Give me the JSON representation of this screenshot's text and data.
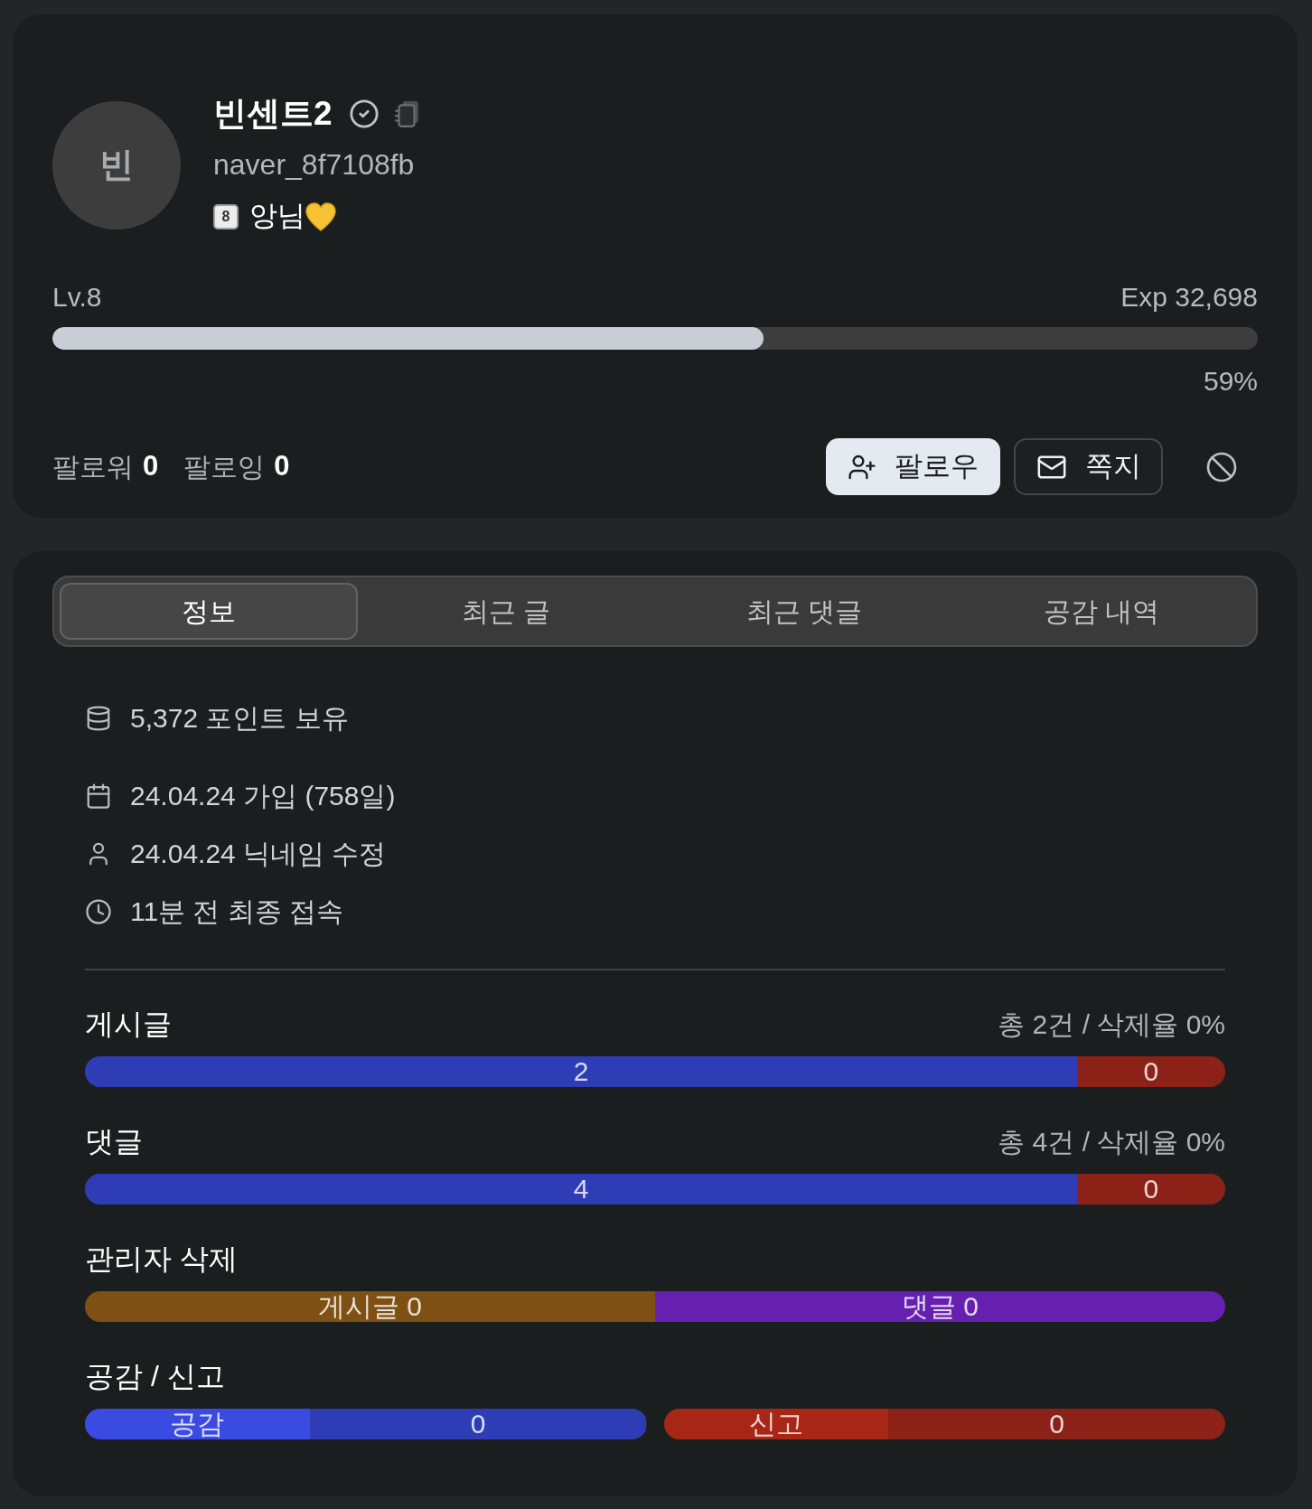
{
  "profile": {
    "avatar_initial": "빈",
    "name": "빈센트2",
    "username": "naver_8f7108fb",
    "level_badge": "8",
    "nickname": "앙님"
  },
  "level": {
    "label": "Lv.8",
    "exp": "Exp 32,698",
    "level": 0.59,
    "percent": "59%"
  },
  "follow": {
    "followers_label": "팔로워",
    "followers": "0",
    "following_label": "팔로잉",
    "following": "0"
  },
  "actions": [
    {
      "kind": "follow",
      "label": "팔로우"
    },
    {
      "kind": "message",
      "label": "쪽지"
    },
    {
      "kind": "block"
    }
  ],
  "tabs": [
    {
      "label": "정보",
      "selected": true
    },
    {
      "label": "최근 글",
      "selected": false
    },
    {
      "label": "최근 댓글",
      "selected": false
    },
    {
      "label": "공감 내역",
      "selected": false
    }
  ],
  "points": {
    "kind": "points",
    "text": "5,372 포인트 보유"
  },
  "details": [
    {
      "kind": "joined",
      "text": "24.04.24 가입 (758일)"
    },
    {
      "kind": "nickname",
      "text": "24.04.24 닉네임 수정"
    },
    {
      "kind": "last_seen",
      "text": "11분 전 최종 접속"
    }
  ],
  "stats": [
    {
      "title": "게시글",
      "summary": "총 2건 / 삭제율 0%",
      "bars": [
        {
          "segments": [
            {
              "label": "2",
              "color": "#2e3db5",
              "level": 0.87
            },
            {
              "label": "0",
              "color": "#8c2118",
              "level": 0.13
            }
          ]
        }
      ]
    },
    {
      "title": "댓글",
      "summary": "총 4건 / 삭제율 0%",
      "bars": [
        {
          "segments": [
            {
              "label": "4",
              "color": "#2e3db5",
              "level": 0.87
            },
            {
              "label": "0",
              "color": "#8c2118",
              "level": 0.13
            }
          ]
        }
      ]
    },
    {
      "title": "관리자 삭제",
      "bars": [
        {
          "segments": [
            {
              "label": "게시글 0",
              "color": "#7e5014",
              "level": 0.5
            },
            {
              "label": "댓글 0",
              "color": "#6620b0",
              "level": 0.5
            }
          ]
        }
      ]
    },
    {
      "title": "공감 / 신고",
      "bars": [
        {
          "segments": [
            {
              "label": "공감",
              "color": "#3a4be2",
              "level": 0.4
            },
            {
              "label": "0",
              "color": "#2e3db5",
              "level": 0.6
            }
          ]
        },
        {
          "segments": [
            {
              "label": "신고",
              "color": "#a82616",
              "level": 0.4
            },
            {
              "label": "0",
              "color": "#8c2118",
              "level": 0.6
            }
          ]
        }
      ]
    }
  ]
}
